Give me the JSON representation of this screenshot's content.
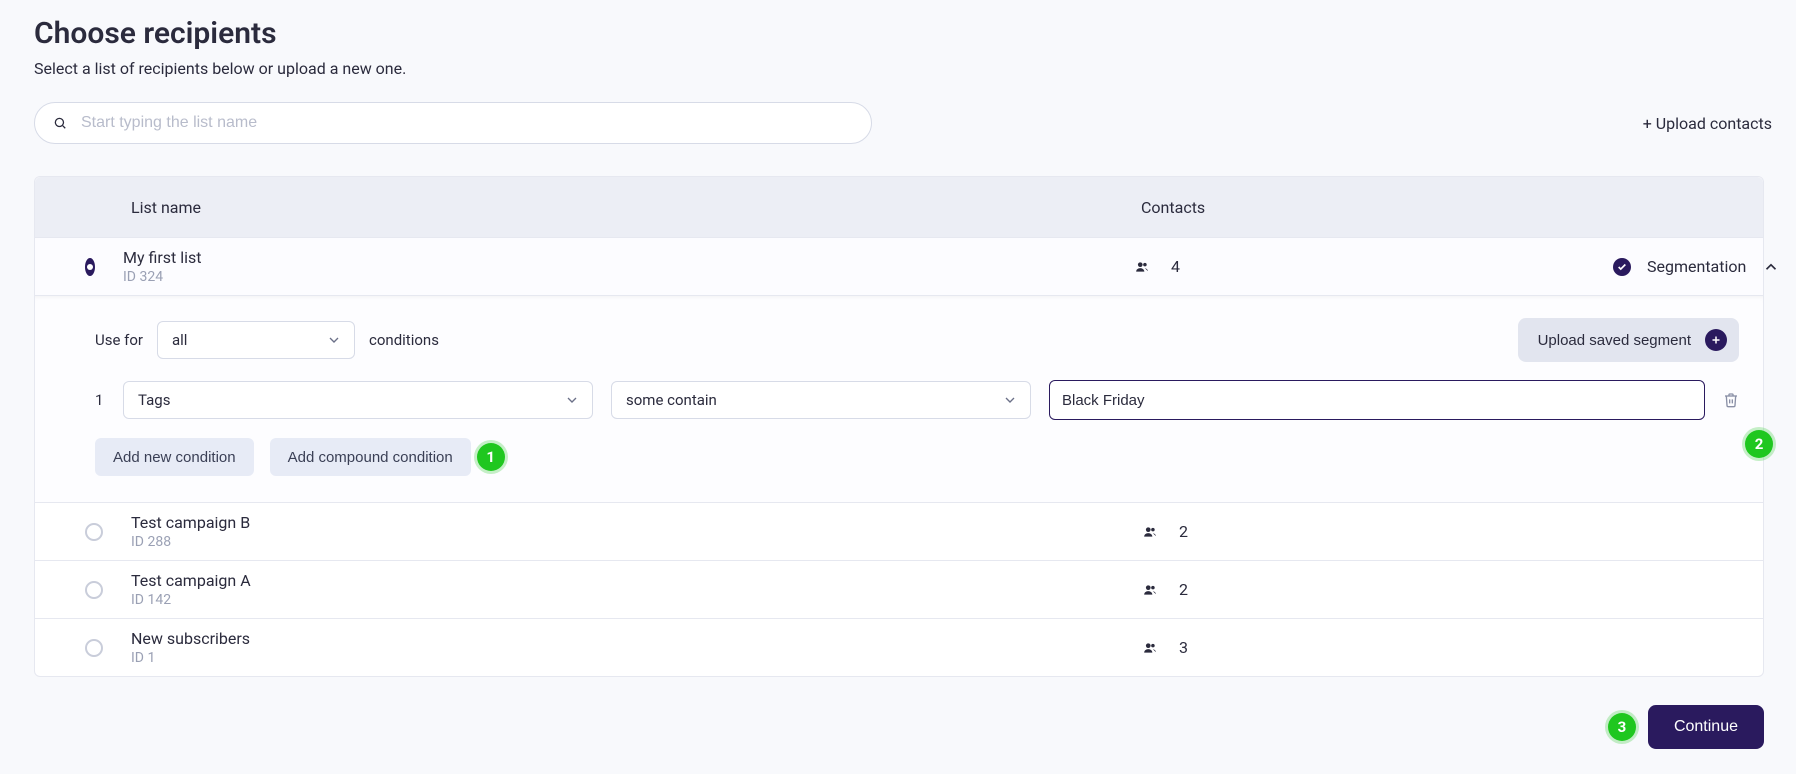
{
  "header": {
    "title": "Choose recipients",
    "subtitle": "Select a list of recipients below or upload a new one."
  },
  "search": {
    "placeholder": "Start typing the list name",
    "value": ""
  },
  "upload_contacts_label": "+ Upload contacts",
  "columns": {
    "name": "List name",
    "contacts": "Contacts"
  },
  "segmentation_label": "Segmentation",
  "lists": [
    {
      "name": "My first list",
      "id_label": "ID 324",
      "contacts": "4",
      "selected": true
    },
    {
      "name": "Test campaign B",
      "id_label": "ID 288",
      "contacts": "2",
      "selected": false
    },
    {
      "name": "Test campaign A",
      "id_label": "ID 142",
      "contacts": "2",
      "selected": false
    },
    {
      "name": "New subscribers",
      "id_label": "ID 1",
      "contacts": "3",
      "selected": false
    }
  ],
  "segment": {
    "use_for_label": "Use for",
    "match": "all",
    "conditions_label": "conditions",
    "upload_saved_label": "Upload saved segment",
    "condition_index": "1",
    "field": "Tags",
    "operator": "some contain",
    "value": "Black Friday",
    "add_condition_label": "Add new condition",
    "add_compound_label": "Add compound condition"
  },
  "footer": {
    "continue_label": "Continue"
  },
  "step_badges": {
    "one": "1",
    "two": "2",
    "three": "3"
  }
}
